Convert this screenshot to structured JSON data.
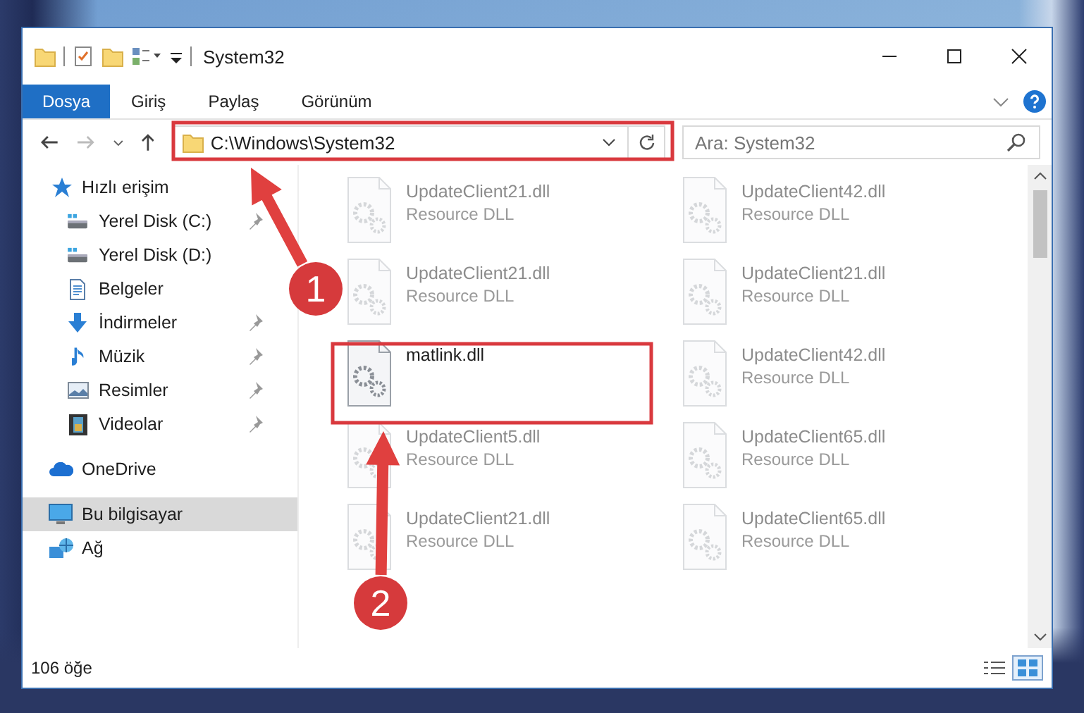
{
  "window": {
    "title": "System32"
  },
  "ribbon": {
    "tabs": [
      {
        "label": "Dosya",
        "kind": "file"
      },
      {
        "label": "Giriş",
        "kind": "tab"
      },
      {
        "label": "Paylaş",
        "kind": "tab"
      },
      {
        "label": "Görünüm",
        "kind": "tab"
      }
    ]
  },
  "address_bar": {
    "path": "C:\\Windows\\System32"
  },
  "search": {
    "placeholder": "Ara: System32"
  },
  "nav_pane": {
    "items": [
      {
        "label": "Hızlı erişim",
        "kind": "star",
        "selected": false,
        "children": [
          {
            "label": "Yerel Disk (C:)",
            "kind": "drive",
            "pinned": true,
            "selected": false
          },
          {
            "label": "Yerel Disk (D:)",
            "kind": "drive",
            "pinned": false,
            "selected": false
          },
          {
            "label": "Belgeler",
            "kind": "document",
            "pinned": false,
            "selected": false
          },
          {
            "label": "İndirmeler",
            "kind": "download",
            "pinned": true,
            "selected": false
          },
          {
            "label": "Müzik",
            "kind": "music",
            "pinned": true,
            "selected": false
          },
          {
            "label": "Resimler",
            "kind": "pictures",
            "pinned": true,
            "selected": false
          },
          {
            "label": "Videolar",
            "kind": "video",
            "pinned": true,
            "selected": false
          }
        ]
      },
      {
        "label": "OneDrive",
        "kind": "cloud",
        "selected": false
      },
      {
        "label": "Bu bilgisayar",
        "kind": "computer",
        "selected": true
      },
      {
        "label": "Ağ",
        "kind": "network",
        "selected": false
      }
    ]
  },
  "files": [
    {
      "name": "UpdateClient21.dll",
      "type": "Resource DLL",
      "faded": true
    },
    {
      "name": "UpdateClient42.dll",
      "type": "Resource DLL",
      "faded": true
    },
    {
      "name": "UpdateClient21.dll",
      "type": "Resource DLL",
      "faded": true
    },
    {
      "name": "UpdateClient21.dll",
      "type": "Resource DLL",
      "faded": true
    },
    {
      "name": "matlink.dll",
      "faded": false
    },
    {
      "name": "UpdateClient42.dll",
      "type": "Resource DLL",
      "faded": true
    },
    {
      "name": "UpdateClient5.dll",
      "type": "Resource DLL",
      "faded": true
    },
    {
      "name": "UpdateClient65.dll",
      "type": "Resource DLL",
      "faded": true
    },
    {
      "name": "UpdateClient21.dll",
      "type": "Resource DLL",
      "faded": true
    },
    {
      "name": "UpdateClient65.dll",
      "type": "Resource DLL",
      "faded": true
    }
  ],
  "status_bar": {
    "count": "106 öğe",
    "view_buttons": [
      {
        "kind": "details",
        "selected": false
      },
      {
        "kind": "large_icons",
        "selected": true
      }
    ]
  },
  "annotations": [
    {
      "number": "1"
    },
    {
      "number": "2"
    }
  ]
}
